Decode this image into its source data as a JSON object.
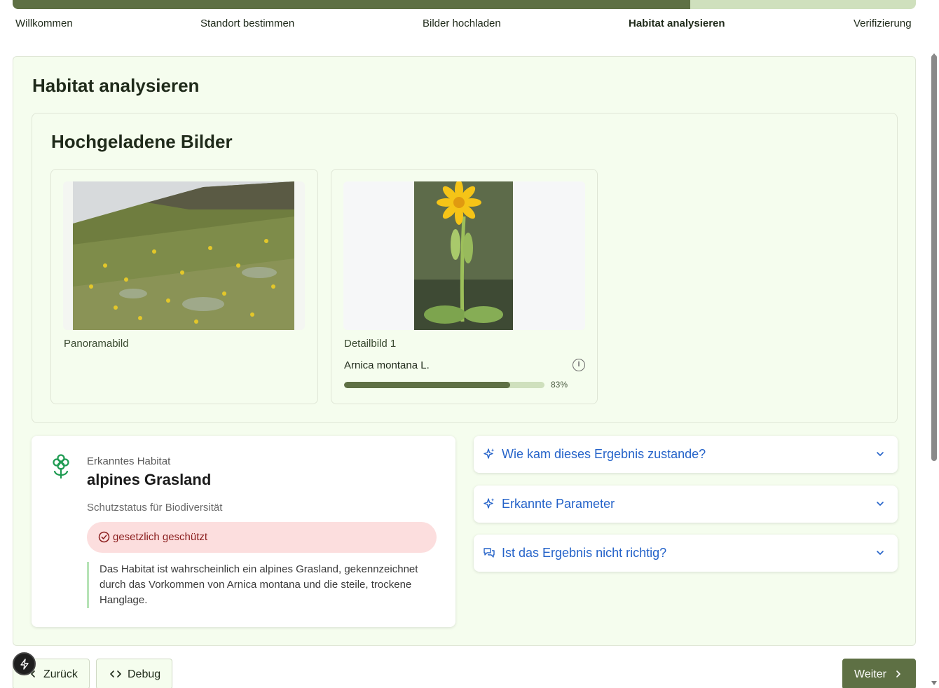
{
  "steps": [
    {
      "label": "Willkommen"
    },
    {
      "label": "Standort bestimmen"
    },
    {
      "label": "Bilder hochladen"
    },
    {
      "label": "Habitat analysieren",
      "active": true
    },
    {
      "label": "Verifizierung"
    }
  ],
  "progress_fraction": 0.75,
  "main": {
    "title": "Habitat analysieren",
    "images_title": "Hochgeladene Bilder",
    "images": [
      {
        "caption": "Panoramabild",
        "icon": "meadow-photo"
      },
      {
        "caption": "Detailbild 1",
        "icon": "arnica-photo",
        "species": "Arnica montana L.",
        "confidence": 0.83,
        "confidence_label": "83%"
      }
    ]
  },
  "habitat": {
    "kicker": "Erkanntes Habitat",
    "name": "alpines Grasland",
    "status_label": "Schutzstatus für Biodiversität",
    "status_text": "gesetzlich geschützt",
    "description": "Das Habitat ist wahrscheinlich ein alpines Grasland, gekennzeichnet durch das Vorkommen von Arnica montana und die steile, trockene Hanglage."
  },
  "accordions": [
    {
      "label": "Wie kam dieses Ergebnis zustande?",
      "icon": "sparkles-icon"
    },
    {
      "label": "Erkannte Parameter",
      "icon": "sparkles-icon"
    },
    {
      "label": "Ist das Ergebnis nicht richtig?",
      "icon": "chat-icon"
    }
  ],
  "buttons": {
    "back": "Zurück",
    "debug": "Debug",
    "next": "Weiter"
  },
  "colors": {
    "accent": "#5e7044",
    "track": "#cfe0bd",
    "link": "#2563c9",
    "danger_bg": "#fcdede",
    "danger_text": "#8a1c1c"
  }
}
